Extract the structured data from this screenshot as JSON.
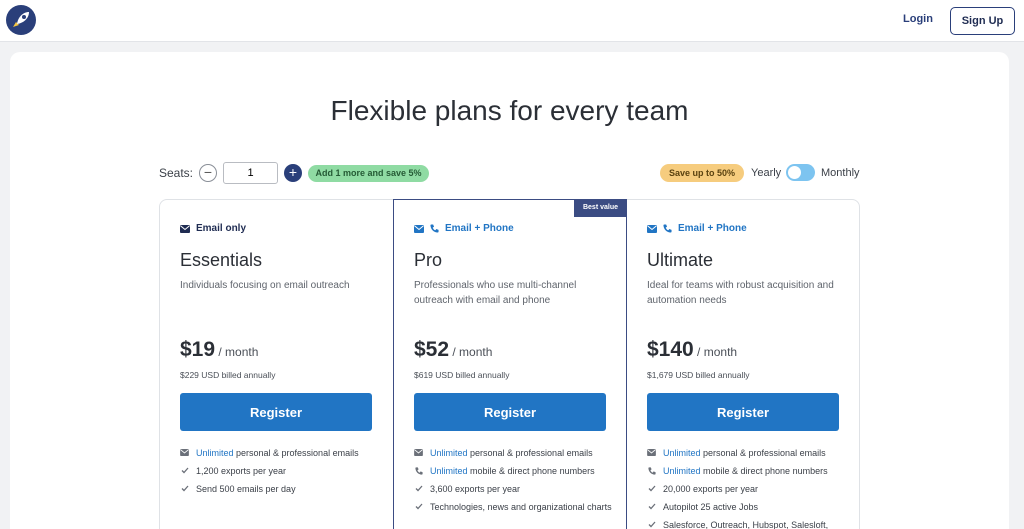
{
  "nav": {
    "login": "Login",
    "signup": "Sign Up"
  },
  "headline": "Flexible plans for every team",
  "seats": {
    "label": "Seats:",
    "minus": "−",
    "value": "1",
    "plus": "+",
    "promo": "Add 1 more and save 5%"
  },
  "billing": {
    "save_badge": "Save up to 50%",
    "yearly": "Yearly",
    "monthly": "Monthly"
  },
  "colors": {
    "brand": "#2175c4",
    "navy": "#2a3f7a",
    "green": "#8fdba3",
    "yellow": "#f6cc7e"
  },
  "plans": [
    {
      "channel": "Email only",
      "name": "Essentials",
      "desc": "Individuals focusing on email outreach",
      "price": "$19",
      "per": " / month",
      "billed": "$229 USD billed annually",
      "register": "Register",
      "features": [
        {
          "icon": "envelope-icon",
          "hl": "Unlimited",
          "text": " personal & professional emails"
        },
        {
          "icon": "check-icon",
          "hl": "",
          "text": "1,200 exports per year"
        },
        {
          "icon": "check-icon",
          "hl": "",
          "text": "Send 500 emails per day"
        }
      ]
    },
    {
      "badge": "Best value",
      "channel": "Email + Phone",
      "name": "Pro",
      "desc": "Professionals who use multi-channel outreach with email and phone",
      "price": "$52",
      "per": " / month",
      "billed": "$619 USD billed annually",
      "register": "Register",
      "features": [
        {
          "icon": "envelope-icon",
          "hl": "Unlimited",
          "text": " personal & professional emails"
        },
        {
          "icon": "phone-icon",
          "hl": "Unlimited",
          "text": " mobile & direct phone numbers"
        },
        {
          "icon": "check-icon",
          "hl": "",
          "text": "3,600 exports per year"
        },
        {
          "icon": "check-icon",
          "hl": "",
          "text": "Technologies, news and organizational charts"
        }
      ]
    },
    {
      "channel": "Email + Phone",
      "name": "Ultimate",
      "desc": "Ideal for teams with robust acquisition and automation needs",
      "price": "$140",
      "per": " / month",
      "billed": "$1,679 USD billed annually",
      "register": "Register",
      "features": [
        {
          "icon": "envelope-icon",
          "hl": "Unlimited",
          "text": " personal & professional emails"
        },
        {
          "icon": "phone-icon",
          "hl": "Unlimited",
          "text": " mobile & direct phone numbers"
        },
        {
          "icon": "check-icon",
          "hl": "",
          "text": "20,000 exports per year"
        },
        {
          "icon": "check-icon",
          "hl": "",
          "text": "Autopilot 25 active Jobs"
        },
        {
          "icon": "check-icon",
          "hl": "",
          "text": "Salesforce, Outreach, Hubspot, Salesloft,"
        }
      ]
    }
  ]
}
